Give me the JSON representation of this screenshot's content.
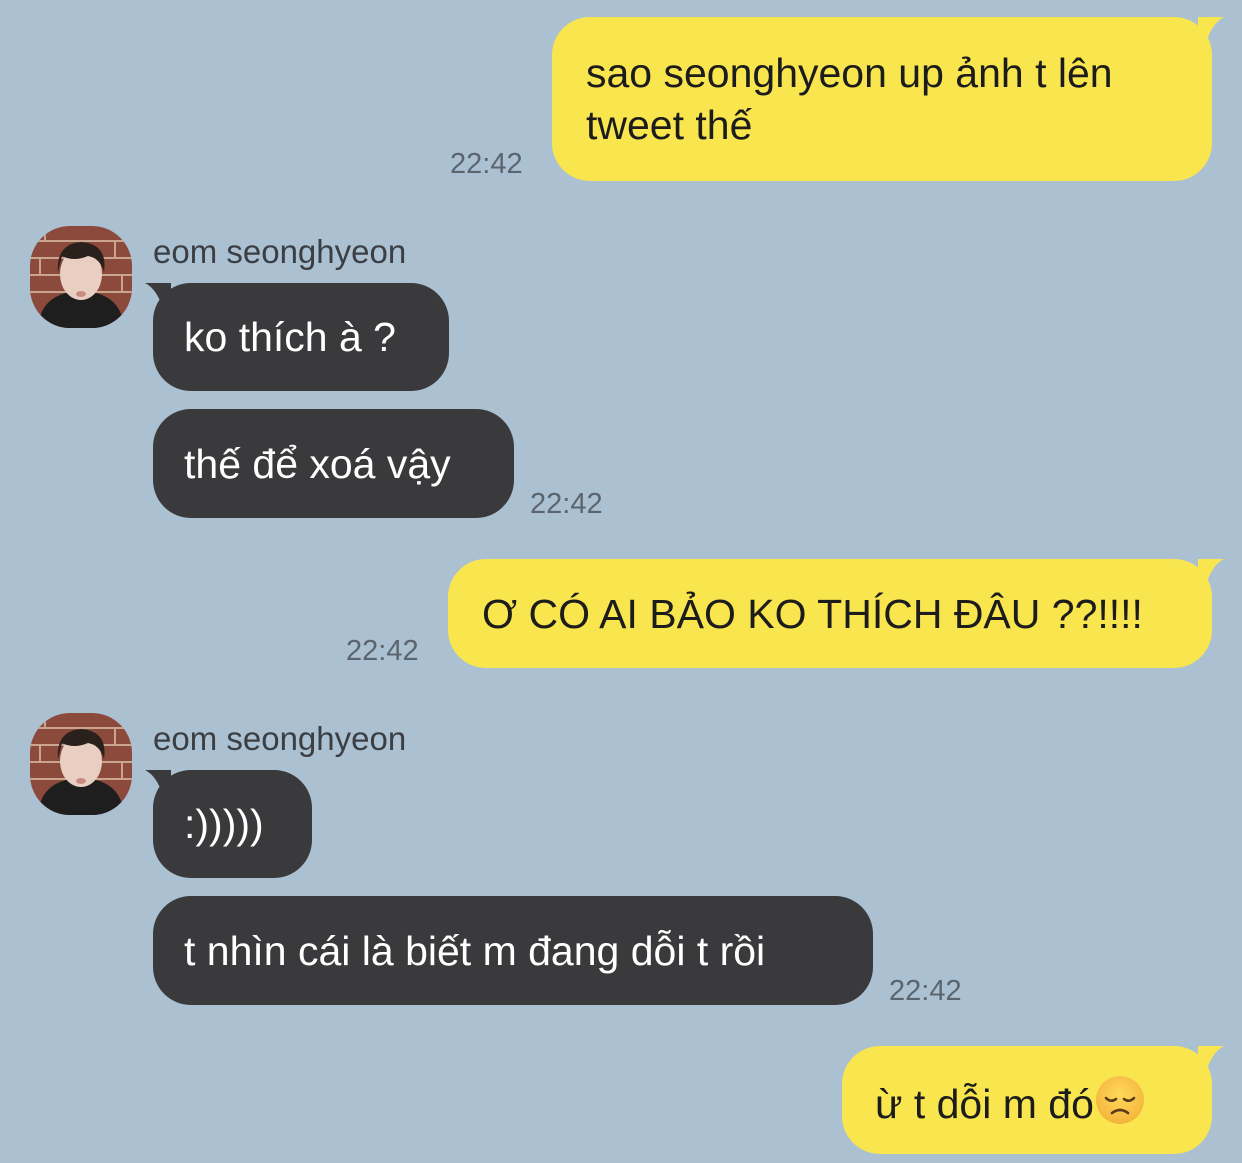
{
  "messages": [
    {
      "text_line1": "sao seonghyeon up ảnh t lên",
      "text_line2": "tweet thế",
      "time": "22:42"
    },
    {
      "sender": "eom seonghyeon",
      "text": "ko thích à ?"
    },
    {
      "text": "thế để xoá vậy",
      "time": "22:42"
    },
    {
      "text": "Ơ CÓ AI BẢO KO THÍCH ĐÂU ??!!!!",
      "time": "22:42"
    },
    {
      "sender": "eom seonghyeon",
      "text": ":)))))"
    },
    {
      "text": "t nhìn cái là biết m đang dỗi t rồi",
      "time": "22:42"
    },
    {
      "text": "ừ t dỗi m đó",
      "emoji": "disappointed-face-icon"
    }
  ],
  "colors": {
    "background": "#abc1d1",
    "outgoing_bubble": "#f9e54e",
    "incoming_bubble": "#3a3a3c"
  }
}
